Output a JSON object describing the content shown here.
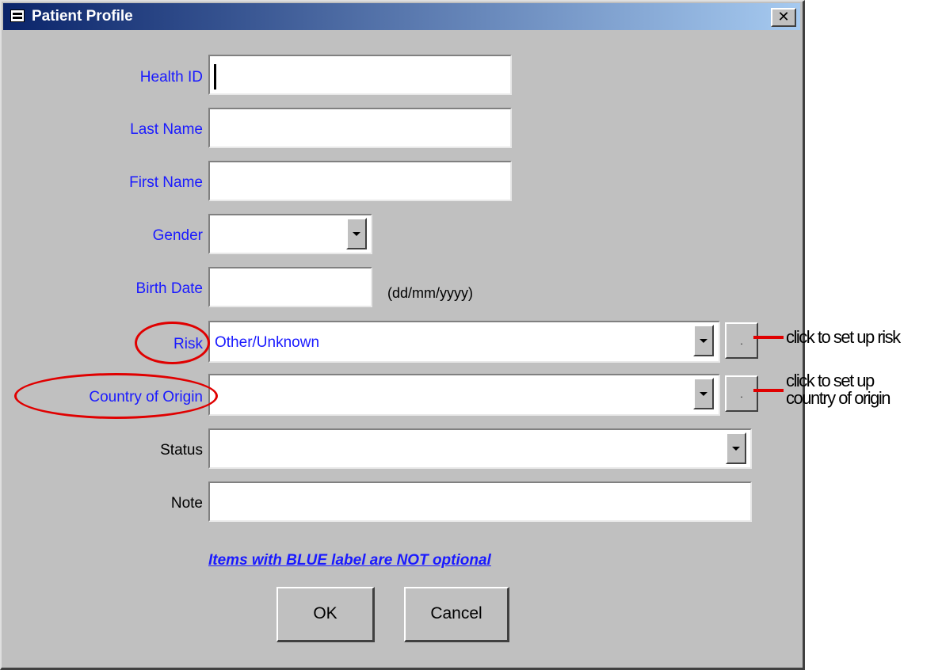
{
  "window": {
    "title": "Patient Profile",
    "close_glyph": "✕",
    "title_icon": "form-icon"
  },
  "fields": {
    "health_id": {
      "label": "Health ID",
      "value": "",
      "required": true
    },
    "last_name": {
      "label": "Last Name",
      "value": "",
      "required": true
    },
    "first_name": {
      "label": "First Name",
      "value": "",
      "required": true
    },
    "gender": {
      "label": "Gender",
      "value": "",
      "required": true
    },
    "birth_date": {
      "label": "Birth Date",
      "value": "",
      "hint": "(dd/mm/yyyy)",
      "required": true
    },
    "risk": {
      "label": "Risk",
      "value": "Other/Unknown",
      "required": true,
      "setup_button": "."
    },
    "country_of_origin": {
      "label": "Country of Origin",
      "value": "",
      "required": true,
      "setup_button": "."
    },
    "status": {
      "label": "Status",
      "value": "",
      "required": false
    },
    "note": {
      "label": "Note",
      "value": "",
      "required": false
    }
  },
  "notice": "Items with BLUE label are NOT optional",
  "buttons": {
    "ok": "OK",
    "cancel": "Cancel"
  },
  "annotations": {
    "risk": "click to set up risk",
    "country_line1": "click to set up",
    "country_line2": "country of origin",
    "color": "#e00000"
  },
  "colors": {
    "required_label": "#1a1aff",
    "window_bg": "#c0c0c0",
    "titlebar_start": "#0a246a",
    "titlebar_end": "#a6caf0"
  }
}
